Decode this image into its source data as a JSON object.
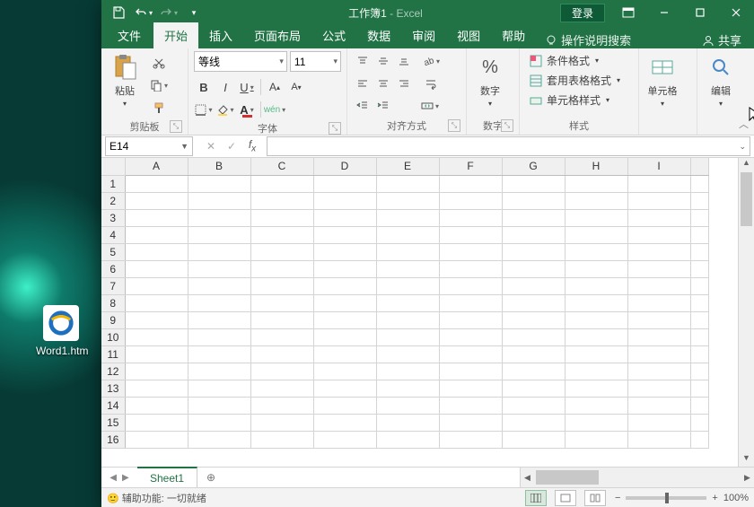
{
  "desktop": {
    "file_label": "Word1.htm"
  },
  "title": {
    "doc": "工作簿1",
    "app": "Excel",
    "login": "登录"
  },
  "tabs": {
    "file": "文件",
    "home": "开始",
    "insert": "插入",
    "layout": "页面布局",
    "formula": "公式",
    "data": "数据",
    "review": "审阅",
    "view": "视图",
    "help": "帮助",
    "tell": "操作说明搜索",
    "share": "共享"
  },
  "ribbon": {
    "clipboard": {
      "paste": "粘贴",
      "label": "剪贴板"
    },
    "font": {
      "name": "等线",
      "size": "11",
      "label": "字体"
    },
    "align": {
      "label": "对齐方式"
    },
    "number": {
      "btn": "数字",
      "label": "数字"
    },
    "styles": {
      "cond": "条件格式",
      "table": "套用表格格式",
      "cell": "单元格样式",
      "label": "样式"
    },
    "cells": {
      "btn": "单元格"
    },
    "editing": {
      "btn": "编辑"
    }
  },
  "namebox": "E14",
  "columns": [
    "A",
    "B",
    "C",
    "D",
    "E",
    "F",
    "G",
    "H",
    "I"
  ],
  "rows": [
    1,
    2,
    3,
    4,
    5,
    6,
    7,
    8,
    9,
    10,
    11,
    12,
    13,
    14,
    15,
    16
  ],
  "sheet_tab": "Sheet1",
  "status": {
    "a11y": "辅助功能: 一切就绪",
    "zoom": "100%"
  }
}
